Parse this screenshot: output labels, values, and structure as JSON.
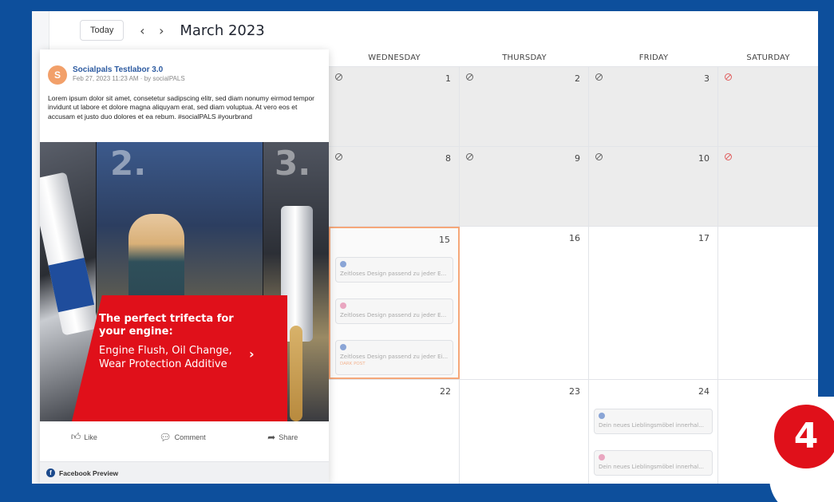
{
  "toolbar": {
    "today_label": "Today",
    "prev_icon": "‹",
    "next_icon": "›",
    "month_title": "March 2023"
  },
  "calendar": {
    "day_headers": [
      "WEDNESDAY",
      "THURSDAY",
      "FRIDAY",
      "SATURDAY"
    ],
    "weeks": [
      {
        "days": [
          "1",
          "2",
          "3",
          ""
        ]
      },
      {
        "days": [
          "8",
          "9",
          "10",
          ""
        ]
      },
      {
        "days": [
          "15",
          "16",
          "17",
          ""
        ]
      },
      {
        "days": [
          "22",
          "23",
          "24",
          ""
        ]
      }
    ],
    "cards": {
      "wed15_a": {
        "network": "facebook",
        "text": "Zeitloses Design passend zu jeder E..."
      },
      "wed15_b": {
        "network": "instagram",
        "text": "Zeitloses Design passend zu jeder E..."
      },
      "wed15_c": {
        "network": "facebook",
        "text": "Zeitloses Design passend zu jeder Ei...",
        "status": "DARK POST"
      },
      "fri24_a": {
        "network": "facebook",
        "text": "Dein neues Lieblingsmöbel innerhal..."
      },
      "fri24_b": {
        "network": "instagram",
        "text": "Dein neues Lieblingsmöbel innerhal..."
      }
    }
  },
  "preview": {
    "avatar_letter": "S",
    "page_name": "Socialpals Testlabor 3.0",
    "date_line": "Feb 27, 2023 11:23 AM · by socialPALS",
    "post_text": "Lorem ipsum dolor sit amet, consetetur sadipscing elitr, sed diam nonumy eirmod tempor invidunt ut labore et dolore magna aliquyam erat, sed diam voluptua. At vero eos et accusam et justo duo dolores et ea rebum. #socialPALS #yourbrand",
    "image": {
      "num2": "2.",
      "num3": "3.",
      "promo_title": "The perfect trifecta for your engine:",
      "promo_body": "Engine Flush, Oil Change, Wear Protection Additive"
    },
    "actions": {
      "like": "Like",
      "comment": "Comment",
      "share": "Share"
    },
    "footer_label": "Facebook Preview"
  },
  "badge": {
    "number": "4"
  },
  "colors": {
    "background": "#0d4f9c",
    "accent_red": "#e0101a",
    "highlight_border": "#f5a779",
    "facebook_blue": "#2c5aa0"
  }
}
